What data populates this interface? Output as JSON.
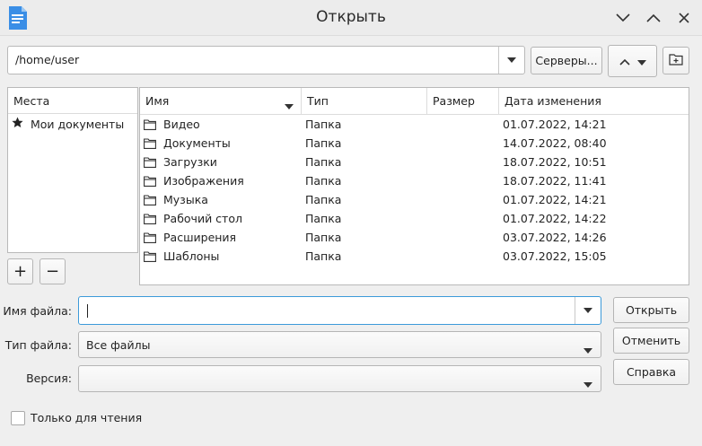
{
  "window": {
    "title": "Открыть",
    "app_icon": "writer-document-icon",
    "controls": [
      "minimize-icon",
      "maximize-icon",
      "close-icon"
    ]
  },
  "toolbar": {
    "path": "/home/user",
    "servers_label": "Серверы...",
    "up_icon": "chevron-up-icon",
    "menu_icon": "dropdown-arrow-icon",
    "new_folder_icon": "new-folder-icon"
  },
  "places": {
    "header": "Места",
    "items": [
      {
        "label": "Мои документы",
        "icon": "star-icon"
      }
    ],
    "add_label": "+",
    "remove_label": "−"
  },
  "files": {
    "columns": [
      "Имя",
      "Тип",
      "Размер",
      "Дата изменения"
    ],
    "rows": [
      {
        "name": "Видео",
        "type": "Папка",
        "size": "",
        "modified": "01.07.2022, 14:21"
      },
      {
        "name": "Документы",
        "type": "Папка",
        "size": "",
        "modified": "14.07.2022, 08:40"
      },
      {
        "name": "Загрузки",
        "type": "Папка",
        "size": "",
        "modified": "18.07.2022, 10:51"
      },
      {
        "name": "Изображения",
        "type": "Папка",
        "size": "",
        "modified": "18.07.2022, 11:41"
      },
      {
        "name": "Музыка",
        "type": "Папка",
        "size": "",
        "modified": "01.07.2022, 14:21"
      },
      {
        "name": "Рабочий стол",
        "type": "Папка",
        "size": "",
        "modified": "01.07.2022, 14:22"
      },
      {
        "name": "Расширения",
        "type": "Папка",
        "size": "",
        "modified": "03.07.2022, 14:26"
      },
      {
        "name": "Шаблоны",
        "type": "Папка",
        "size": "",
        "modified": "03.07.2022, 15:05"
      }
    ]
  },
  "form": {
    "filename_label": "Имя файла:",
    "filename_value": "",
    "filetype_label": "Тип файла:",
    "filetype_value": "Все файлы",
    "version_label": "Версия:",
    "version_value": "",
    "readonly_label": "Только для чтения",
    "readonly_checked": false
  },
  "actions": {
    "open": "Открыть",
    "cancel": "Отменить",
    "help": "Справка"
  },
  "colors": {
    "background": "#efefef",
    "focus": "#3c9ad9",
    "app_icon": "#3a8ee6"
  }
}
